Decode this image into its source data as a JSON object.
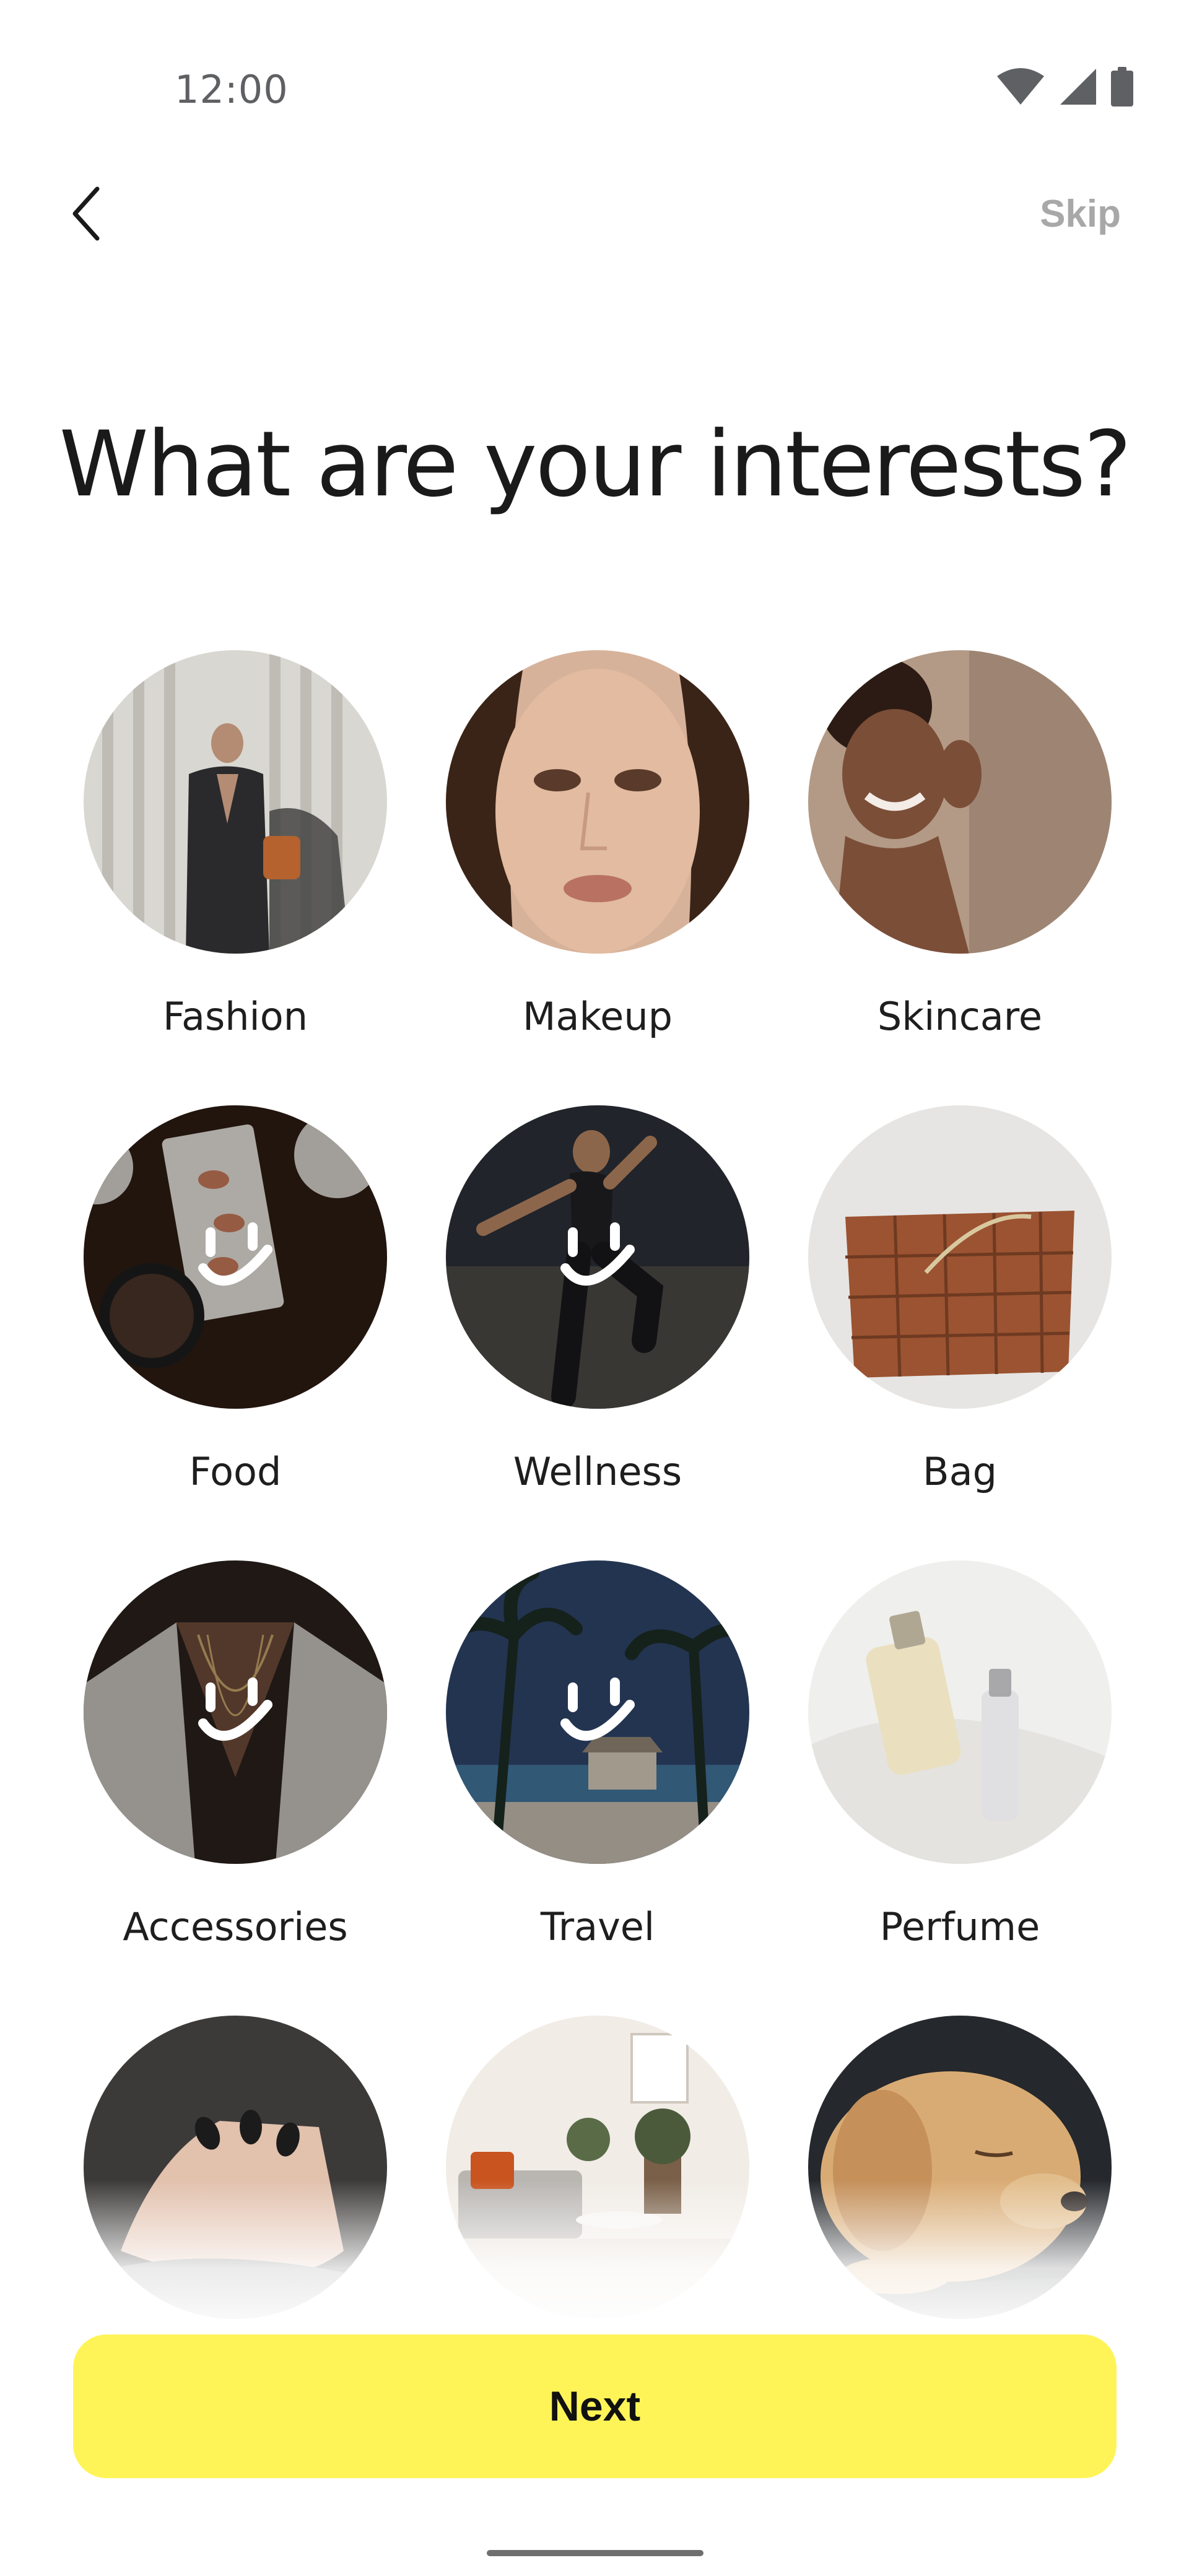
{
  "status_bar": {
    "time": "12:00",
    "icons": [
      "wifi-icon",
      "cellular-signal-icon",
      "battery-icon"
    ]
  },
  "header": {
    "back_icon": "chevron-left-icon",
    "skip_label": "Skip"
  },
  "title": "What are your interests?",
  "interests": [
    {
      "label": "Fashion",
      "selected": false
    },
    {
      "label": "Makeup",
      "selected": false
    },
    {
      "label": "Skincare",
      "selected": false
    },
    {
      "label": "Food",
      "selected": true
    },
    {
      "label": "Wellness",
      "selected": true
    },
    {
      "label": "Bag",
      "selected": false
    },
    {
      "label": "Accessories",
      "selected": true
    },
    {
      "label": "Travel",
      "selected": true
    },
    {
      "label": "Perfume",
      "selected": false
    },
    {
      "label": "",
      "selected": false
    },
    {
      "label": "",
      "selected": false
    },
    {
      "label": "",
      "selected": false
    }
  ],
  "next_button": {
    "label": "Next"
  },
  "colors": {
    "accent": "#fff457",
    "skip_text": "#a8a8a8",
    "title_text": "#1a1a1a"
  }
}
